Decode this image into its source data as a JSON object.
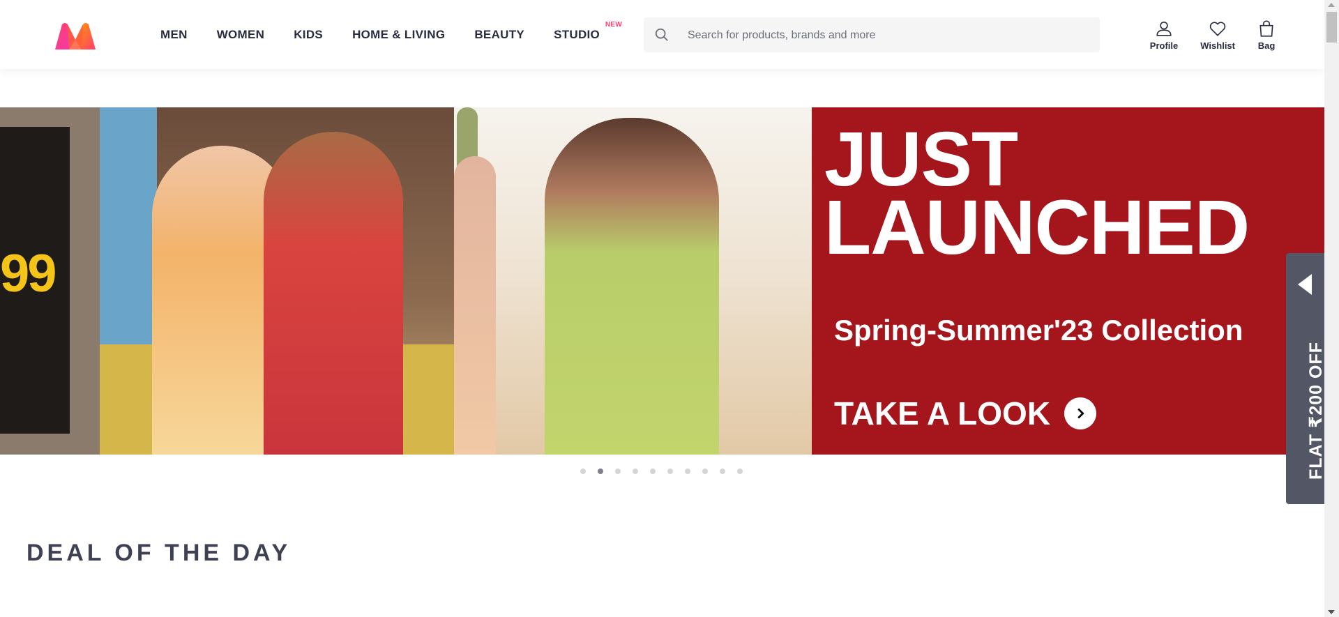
{
  "header": {
    "nav": [
      {
        "label": "MEN"
      },
      {
        "label": "WOMEN"
      },
      {
        "label": "KIDS"
      },
      {
        "label": "HOME & LIVING"
      },
      {
        "label": "BEAUTY"
      },
      {
        "label": "STUDIO",
        "tag": "NEW"
      }
    ],
    "search": {
      "placeholder": "Search for products, brands and more",
      "value": ""
    },
    "actions": [
      {
        "label": "Profile",
        "icon": "profile-icon"
      },
      {
        "label": "Wishlist",
        "icon": "heart-icon"
      },
      {
        "label": "Bag",
        "icon": "bag-icon"
      }
    ]
  },
  "banner": {
    "price_fragment": "99",
    "headline_line1": "JUST",
    "headline_line2": "LAUNCHED",
    "collection": "Spring-Summer'23 Collection",
    "cta": "TAKE A LOOK",
    "accent_color": "#a5161c",
    "dots": {
      "total": 10,
      "active_index": 1
    }
  },
  "deal_of_the_day": {
    "title": "DEAL OF THE DAY"
  },
  "side_offer": {
    "label": "FLAT ₹200 OFF"
  },
  "colors": {
    "brand_pink": "#ff3f6c",
    "text_dark": "#282c3f",
    "offer_bg": "#535665"
  }
}
